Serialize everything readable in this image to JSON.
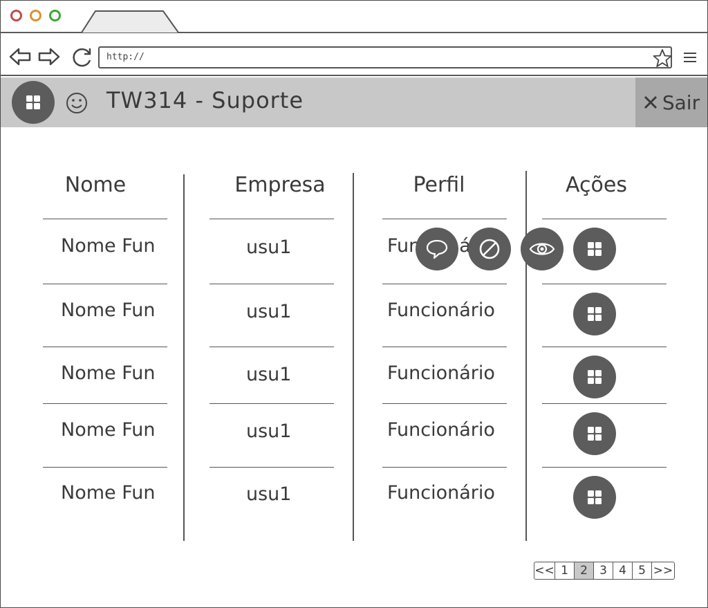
{
  "browser": {
    "url": "http://",
    "icons": {
      "back": "back-arrow-icon",
      "forward": "forward-arrow-icon",
      "reload": "reload-icon",
      "bookmark": "star-icon",
      "menu": "hamburger-icon"
    }
  },
  "header": {
    "title": "TW314 -  Suporte",
    "logout_label": "Sair",
    "icons": {
      "home": "grid-icon",
      "user": "smiley-icon",
      "logout": "close-icon"
    }
  },
  "table": {
    "headers": [
      "Nome",
      "Empresa",
      "Perfil",
      "Ações"
    ],
    "rows": [
      {
        "nome": "Nome Fun",
        "empresa": "usu1",
        "perfil": "Funcionário"
      },
      {
        "nome": "Nome Fun",
        "empresa": "usu1",
        "perfil": "Funcionário"
      },
      {
        "nome": "Nome Fun",
        "empresa": "usu1",
        "perfil": "Funcionário"
      },
      {
        "nome": "Nome Fun",
        "empresa": "usu1",
        "perfil": "Funcionário"
      },
      {
        "nome": "Nome Fun",
        "empresa": "usu1",
        "perfil": "Funcionário"
      }
    ],
    "expanded_row_actions": [
      "comment-icon",
      "block-icon",
      "eye-icon",
      "grid-icon"
    ]
  },
  "pagination": {
    "first": "<<",
    "pages": [
      "1",
      "2",
      "3",
      "4",
      "5"
    ],
    "current": "2",
    "last": ">>"
  },
  "colors": {
    "appbar": "#c8c8c8",
    "logout_bg": "#a8a8a8",
    "button": "#5c5c5c"
  }
}
